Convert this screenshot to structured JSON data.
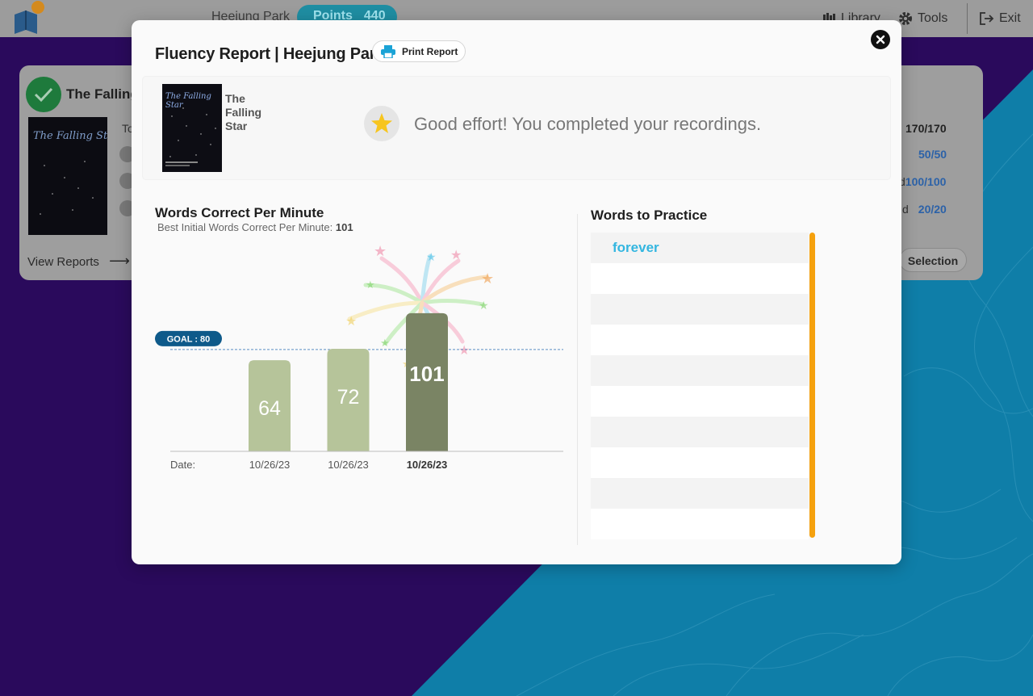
{
  "topbar": {
    "user_name": "Heejung Park",
    "points_label": "Points",
    "points_value": "440",
    "library_label": "Library",
    "tools_label": "Tools",
    "exit_label": "Exit"
  },
  "background_card": {
    "book_title": "The Falling",
    "to_label": "To",
    "stat_1": "170/170",
    "stat_2": "50/50",
    "stat_3_prefix": "d",
    "stat_3": "100/100",
    "stat_4_prefix": "d",
    "stat_4": "20/20",
    "view_reports": "View Reports",
    "selection": "Selection"
  },
  "modal": {
    "title": "Fluency Report | Heejung Park",
    "print_label": "Print Report",
    "summary": {
      "book_title": "The Falling Star",
      "cover_title": "The Falling Star",
      "message": "Good effort! You completed your recordings."
    },
    "wcpm": {
      "title": "Words Correct Per Minute",
      "subtitle_label": "Best Initial Words Correct Per Minute:",
      "subtitle_value": "101"
    },
    "words_to_practice": {
      "title": "Words to Practice",
      "words": [
        "forever",
        "",
        "",
        "",
        "",
        "",
        "",
        "",
        "",
        ""
      ]
    }
  },
  "chart_data": {
    "type": "bar",
    "goal_label": "GOAL : 80",
    "goal_value": 80,
    "date_label": "Date:",
    "categories": [
      "10/26/23",
      "10/26/23",
      "10/26/23"
    ],
    "values": [
      64,
      72,
      101
    ],
    "highlight_index": 2,
    "ylim": [
      0,
      110
    ],
    "colors": {
      "bar": "#b6c49a",
      "highlight": "#7a8464",
      "goal": "#0e5a8a"
    }
  }
}
